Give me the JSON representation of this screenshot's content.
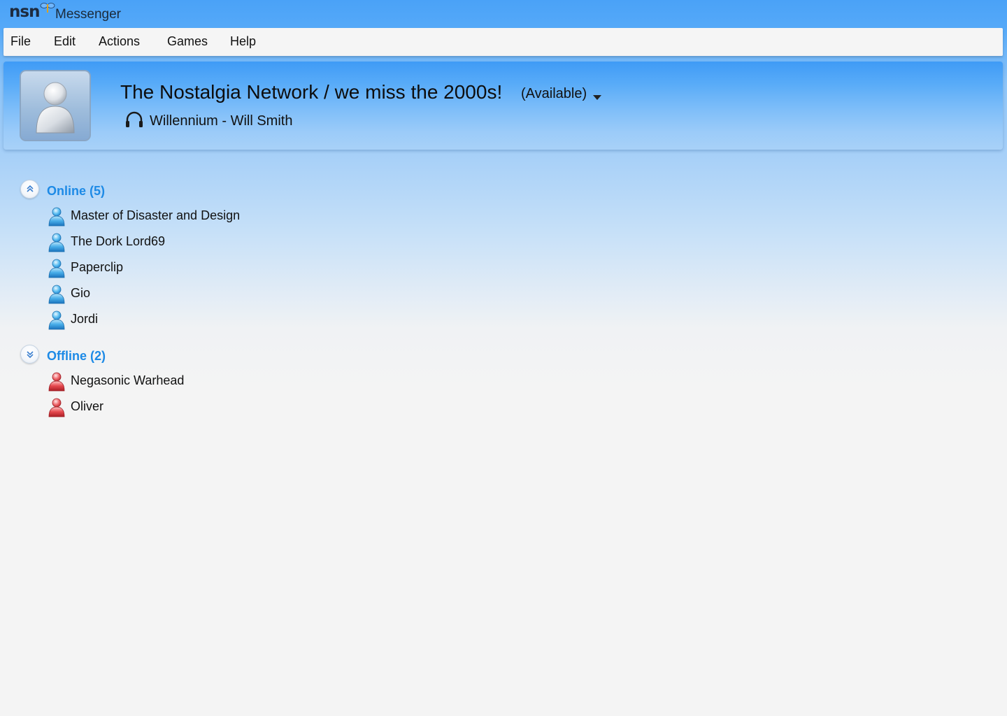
{
  "window": {
    "logo_text": "nsn",
    "app_name": "Messenger"
  },
  "menu": {
    "items": [
      {
        "label": "File"
      },
      {
        "label": "Edit"
      },
      {
        "label": "Actions"
      },
      {
        "label": "Games"
      },
      {
        "label": "Help"
      }
    ]
  },
  "profile": {
    "display_name": "The Nostalgia Network / we miss the 2000s!",
    "status": "(Available)",
    "now_playing": "Willennium - Will Smith",
    "avatar_icon": "default-user-avatar",
    "now_playing_icon": "headphones-icon"
  },
  "groups": {
    "online": {
      "label": "Online (5)",
      "state": "expanded",
      "color": "#1d8ae6",
      "contacts": [
        {
          "name": "Master of Disaster and Design",
          "status": "online"
        },
        {
          "name": "The Dork Lord69",
          "status": "online"
        },
        {
          "name": "Paperclip",
          "status": "online"
        },
        {
          "name": "Gio",
          "status": "online"
        },
        {
          "name": "Jordi",
          "status": "online"
        }
      ]
    },
    "offline": {
      "label": "Offline (2)",
      "state": "collapsed",
      "color": "#1d8ae6",
      "contacts": [
        {
          "name": "Negasonic Warhead",
          "status": "offline"
        },
        {
          "name": "Oliver",
          "status": "offline"
        }
      ]
    }
  },
  "colors": {
    "online_buddy": "#3aa6e8",
    "offline_buddy": "#e0474c",
    "header_blue": "#4aa2f7"
  }
}
